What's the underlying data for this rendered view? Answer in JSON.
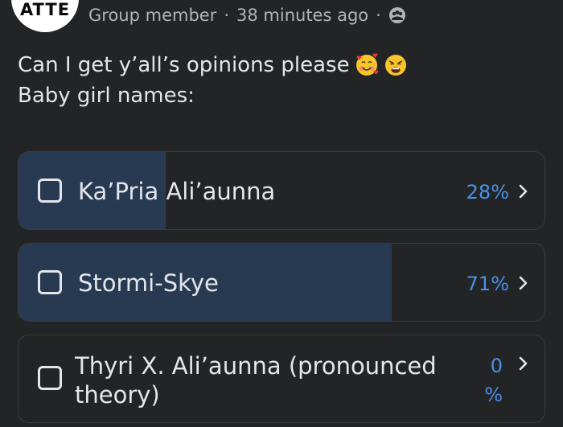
{
  "header": {
    "avatar_text": "ATTE",
    "role": "Group member",
    "separator": "·",
    "time": "38 minutes ago",
    "audience_icon": "group-icon"
  },
  "post": {
    "line1": "Can I get y’all’s opinions please",
    "line2": "Baby girl names:",
    "emojis": [
      "smiling-face-with-hearts",
      "weary-face"
    ]
  },
  "poll": {
    "options": [
      {
        "label": "Ka’Pria Ali’aunna",
        "percent": "28%",
        "fill_fraction": 0.28
      },
      {
        "label": "Stormi-Skye",
        "percent": "71%",
        "fill_fraction": 0.71
      },
      {
        "label_line1": "Thyri X. Ali’aunna (pronounced",
        "label_line2": "theory)",
        "percent_line1": "0",
        "percent_line2": "%",
        "fill_fraction": 0.0
      }
    ]
  },
  "colors": {
    "background": "#232425",
    "text": "#e4e6eb",
    "muted": "#b0b3b8",
    "percent_blue": "#4b8fe8",
    "fill": "#283a52",
    "border": "#3a3b3c"
  }
}
